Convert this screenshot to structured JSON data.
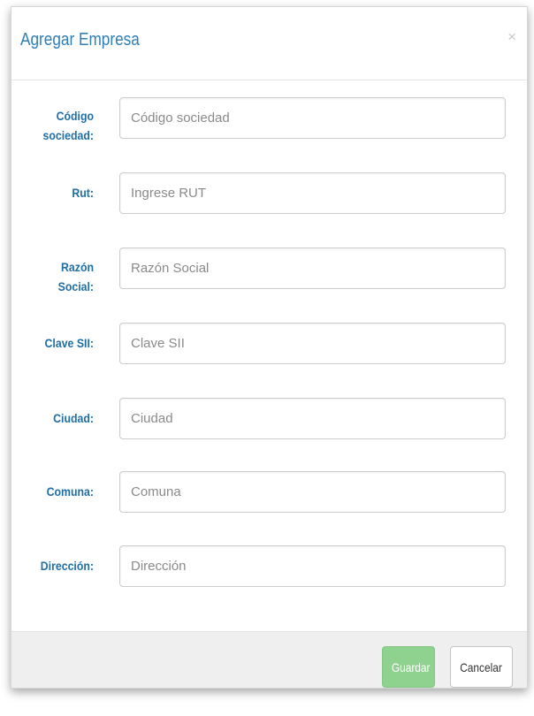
{
  "modal": {
    "title": "Agregar Empresa",
    "close_label": "×"
  },
  "form": {
    "fields": [
      {
        "label_line1": "Código",
        "label_line2": "sociedad:",
        "placeholder": "Código sociedad"
      },
      {
        "label_line1": "Rut:",
        "label_line2": "",
        "placeholder": "Ingrese RUT"
      },
      {
        "label_line1": "Razón",
        "label_line2": "Social:",
        "placeholder": "Razón Social"
      },
      {
        "label_line1": "Clave SII:",
        "label_line2": "",
        "placeholder": "Clave SII"
      },
      {
        "label_line1": "Ciudad:",
        "label_line2": "",
        "placeholder": "Ciudad"
      },
      {
        "label_line1": "Comuna:",
        "label_line2": "",
        "placeholder": "Comuna"
      },
      {
        "label_line1": "Dirección:",
        "label_line2": "",
        "placeholder": "Dirección"
      }
    ]
  },
  "footer": {
    "save_label": "Guardar",
    "cancel_label": "Cancelar"
  },
  "colors": {
    "title": "#2f7fb5",
    "label": "#1f6fa6",
    "save_button": "#8fd18f",
    "footer_bg": "#efefef"
  }
}
